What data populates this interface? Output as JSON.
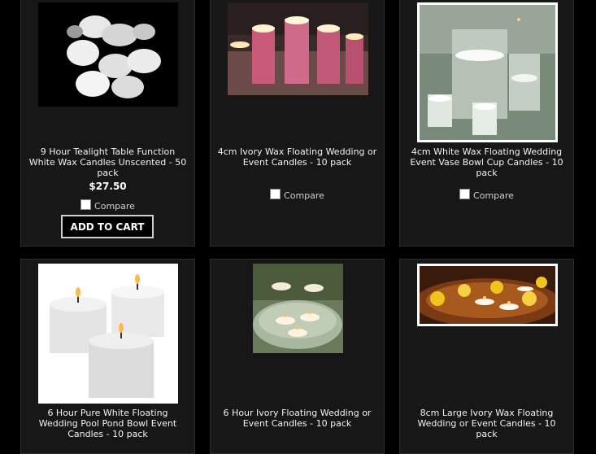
{
  "products": [
    {
      "title": "9 Hour Tealight Table Function White Wax Candles Unscented - 50 pack",
      "price": "$27.50",
      "compare_label": "Compare",
      "cart_label": "ADD TO CART",
      "image_icon": "tealight-candles-image"
    },
    {
      "title": "4cm Ivory Wax Floating Wedding or Event Candles - 10 pack",
      "compare_label": "Compare",
      "image_icon": "floating-candles-table-image"
    },
    {
      "title": "4cm White Wax Floating Wedding Event Vase Bowl Cup Candles - 10 pack",
      "compare_label": "Compare",
      "image_icon": "vase-candles-image"
    },
    {
      "title": "6 Hour Pure White Floating Wedding Pool Pond Bowl Event Candles - 10 pack",
      "image_icon": "white-floating-candles-image"
    },
    {
      "title": "6 Hour Ivory Floating Wedding or Event Candles - 10 pack",
      "image_icon": "bowl-floating-candles-image"
    },
    {
      "title": "8cm Large Ivory Wax Floating Wedding or Event Candles - 10 pack",
      "image_icon": "flowers-floating-candles-image"
    }
  ]
}
